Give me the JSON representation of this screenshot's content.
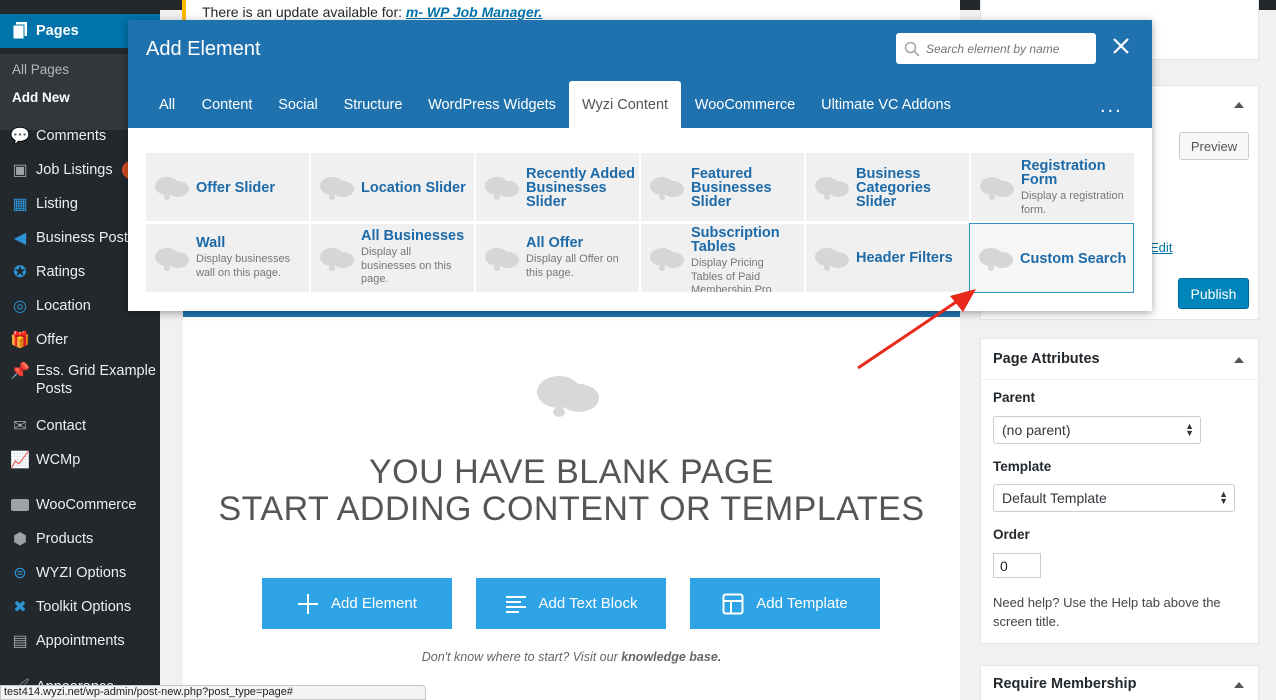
{
  "sidebar": {
    "pages_label": "Pages",
    "submenu": [
      "All Pages",
      "Add New"
    ],
    "items": [
      {
        "label": "Comments",
        "icon": "comment-icon"
      },
      {
        "label": "Job Listings",
        "icon": "briefcase-icon"
      },
      {
        "label": "Listing",
        "icon": "store-icon"
      },
      {
        "label": "Business Post",
        "icon": "megaphone-icon"
      },
      {
        "label": "Ratings",
        "icon": "star-icon"
      },
      {
        "label": "Location",
        "icon": "location-icon"
      },
      {
        "label": "Offer",
        "icon": "gift-icon"
      },
      {
        "label": "Ess. Grid Example Posts",
        "icon": "pin-icon"
      },
      {
        "label": "Contact",
        "icon": "mail-icon"
      },
      {
        "label": "WCMp",
        "icon": "chart-icon"
      },
      {
        "label": "WooCommerce",
        "icon": "woo-icon"
      },
      {
        "label": "Products",
        "icon": "box-icon"
      },
      {
        "label": "WYZI Options",
        "icon": "toggle-icon"
      },
      {
        "label": "Toolkit Options",
        "icon": "tools-icon"
      },
      {
        "label": "Appointments",
        "icon": "calendar-icon"
      },
      {
        "label": "Appearance",
        "icon": "brush-icon"
      }
    ]
  },
  "notice": {
    "text": "There is an update available for:",
    "link": "m- WP Job Manager."
  },
  "modal": {
    "title": "Add Element",
    "search_placeholder": "Search element by name",
    "tabs": [
      "All",
      "Content",
      "Social",
      "Structure",
      "WordPress Widgets",
      "Wyzi Content",
      "WooCommerce",
      "Ultimate VC Addons"
    ],
    "active_tab": "Wyzi Content",
    "more": "...",
    "elements": [
      {
        "title": "Offer Slider",
        "desc": ""
      },
      {
        "title": "Location Slider",
        "desc": ""
      },
      {
        "title": "Recently Added Businesses Slider",
        "desc": ""
      },
      {
        "title": "Featured Businesses Slider",
        "desc": ""
      },
      {
        "title": "Business Categories Slider",
        "desc": ""
      },
      {
        "title": "Registration Form",
        "desc": "Display a registration form."
      },
      {
        "title": "Wall",
        "desc": "Display businesses wall on this page."
      },
      {
        "title": "All Businesses",
        "desc": "Display all businesses on this page."
      },
      {
        "title": "All Offer",
        "desc": "Display all Offer on this page."
      },
      {
        "title": "Subscription Tables",
        "desc": "Display Pricing Tables of Paid Membership Pro"
      },
      {
        "title": "Header Filters",
        "desc": ""
      },
      {
        "title": "Custom Search",
        "desc": ""
      }
    ]
  },
  "editor": {
    "blank_line1": "YOU HAVE BLANK PAGE",
    "blank_line2": "START ADDING CONTENT OR TEMPLATES",
    "buttons": [
      "Add Element",
      "Add Text Block",
      "Add Template"
    ],
    "hint_prefix": "Don't know where to start? Visit our",
    "hint_link": "knowledge base."
  },
  "publish": {
    "preview": "Preview",
    "edit": "Edit",
    "publish": "Publish"
  },
  "attributes": {
    "title": "Page Attributes",
    "parent_label": "Parent",
    "parent_value": "(no parent)",
    "template_label": "Template",
    "template_value": "Default Template",
    "order_label": "Order",
    "order_value": "0",
    "help": "Need help? Use the Help tab above the screen title."
  },
  "membership": {
    "title": "Require Membership"
  },
  "status_url": "test414.wyzi.net/wp-admin/post-new.php?post_type=page#"
}
